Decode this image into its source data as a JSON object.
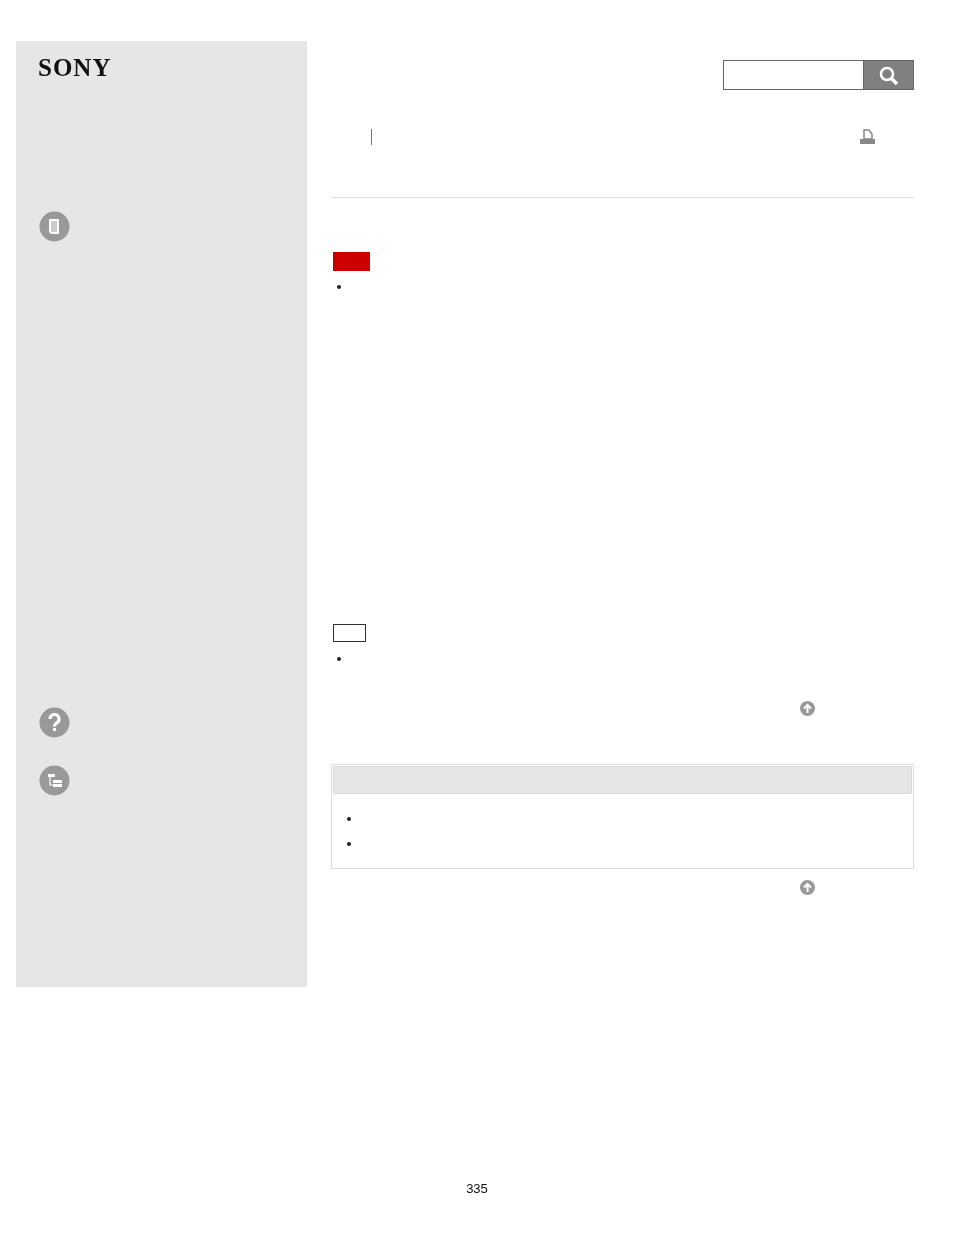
{
  "logo": {
    "text": "SONY"
  },
  "page_number": "335"
}
